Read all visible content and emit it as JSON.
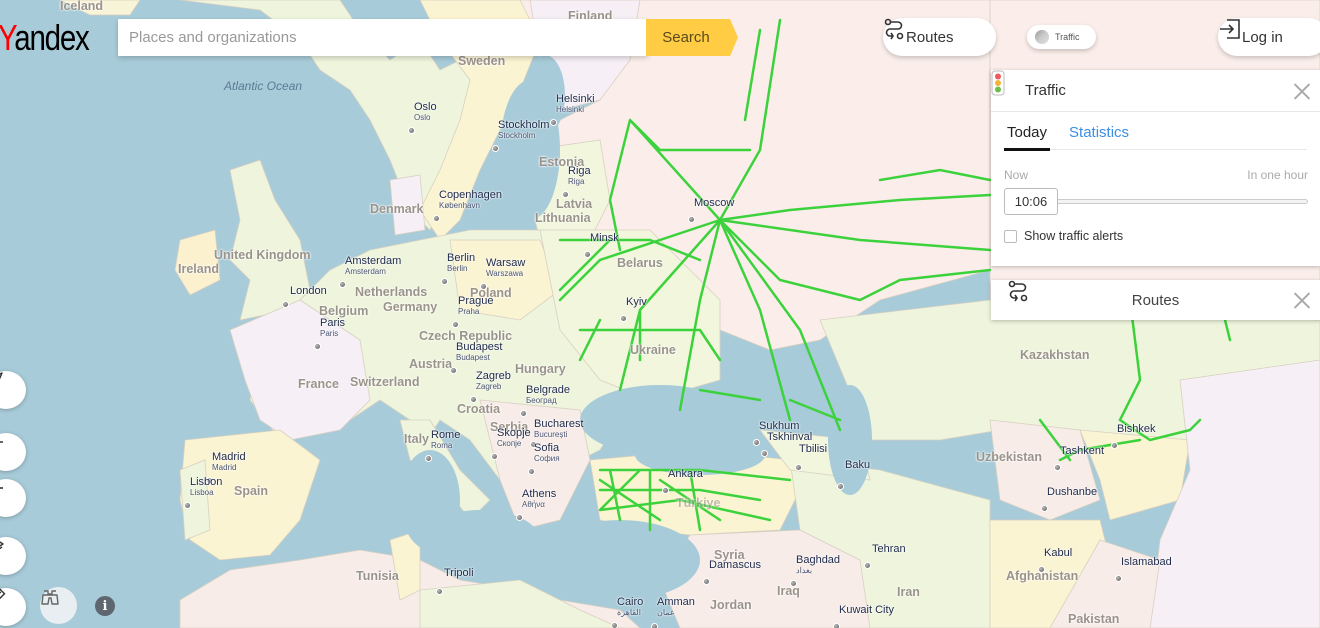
{
  "header": {
    "logo_first": "Y",
    "logo_rest": "andex",
    "search_placeholder": "Places and organizations",
    "search_value": "",
    "search_button": "Search",
    "routes_button": "Routes",
    "traffic_toggle": "Traffic",
    "login_button": "Log in"
  },
  "traffic_panel": {
    "title": "Traffic",
    "tabs": [
      {
        "label": "Today",
        "active": true
      },
      {
        "label": "Statistics",
        "active": false
      }
    ],
    "range_start": "Now",
    "range_end": "In one hour",
    "time": "10:06",
    "slider_position": 0,
    "alerts_label": "Show traffic alerts",
    "alerts_checked": false,
    "traffic_light_colors": [
      "#f05a5a",
      "#f5b23a",
      "#6cbf4a"
    ]
  },
  "routes_panel": {
    "title": "Routes"
  },
  "controls": {
    "locate": "navigation-arrow",
    "zoom_in": "plus",
    "zoom_out": "minus",
    "layers": "layers",
    "ruler": "ruler",
    "panorama": "binoculars",
    "info": "info"
  },
  "map": {
    "ocean_labels": [
      "Atlantic Ocean"
    ],
    "countries": [
      "Iceland",
      "Finland",
      "Sweden",
      "Estonia",
      "Latvia",
      "Lithuania",
      "Denmark",
      "United Kingdom",
      "Ireland",
      "Netherlands",
      "Belgium",
      "Germany",
      "Poland",
      "Belarus",
      "Czech Republic",
      "Austria",
      "Hungary",
      "Switzerland",
      "France",
      "Ukraine",
      "Croatia",
      "Serbia",
      "Italy",
      "Spain",
      "Tunisia",
      "Syria",
      "Iraq",
      "Iran",
      "Jordan",
      "Kazakhstan",
      "Uzbekistan",
      "Afghanistan",
      "Pakistan",
      "Türkiye"
    ],
    "cities": [
      {
        "name": "Oslo",
        "local": "Oslo"
      },
      {
        "name": "Stockholm",
        "local": "Stockholm"
      },
      {
        "name": "Helsinki",
        "local": "Helsinki"
      },
      {
        "name": "Riga",
        "local": "Riga"
      },
      {
        "name": "Copenhagen",
        "local": "København"
      },
      {
        "name": "Amsterdam",
        "local": "Amsterdam"
      },
      {
        "name": "Berlin",
        "local": "Berlin"
      },
      {
        "name": "Warsaw",
        "local": "Warszawa"
      },
      {
        "name": "London",
        "local": ""
      },
      {
        "name": "Paris",
        "local": "Paris"
      },
      {
        "name": "Prague",
        "local": "Praha"
      },
      {
        "name": "Budapest",
        "local": "Budapest"
      },
      {
        "name": "Zagreb",
        "local": "Zagreb"
      },
      {
        "name": "Belgrade",
        "local": "Београд"
      },
      {
        "name": "Bucharest",
        "local": "București"
      },
      {
        "name": "Rome",
        "local": "Roma"
      },
      {
        "name": "Skopje",
        "local": "Скопје"
      },
      {
        "name": "Sofia",
        "local": "София"
      },
      {
        "name": "Madrid",
        "local": "Madrid"
      },
      {
        "name": "Lisbon",
        "local": "Lisboa"
      },
      {
        "name": "Athens",
        "local": "Αθήνα"
      },
      {
        "name": "Tripoli",
        "local": ""
      },
      {
        "name": "Minsk",
        "local": ""
      },
      {
        "name": "Moscow",
        "local": ""
      },
      {
        "name": "Kyiv",
        "local": ""
      },
      {
        "name": "Ankara",
        "local": ""
      },
      {
        "name": "Sukhum",
        "local": ""
      },
      {
        "name": "Tskhinval",
        "local": ""
      },
      {
        "name": "Tbilisi",
        "local": ""
      },
      {
        "name": "Baku",
        "local": ""
      },
      {
        "name": "Tehran",
        "local": ""
      },
      {
        "name": "Baghdad",
        "local": "بغداد"
      },
      {
        "name": "Damascus",
        "local": ""
      },
      {
        "name": "Amman",
        "local": "عمان"
      },
      {
        "name": "Cairo",
        "local": "القاهرة"
      },
      {
        "name": "Kuwait City",
        "local": ""
      },
      {
        "name": "Tashkent",
        "local": ""
      },
      {
        "name": "Bishkek",
        "local": ""
      },
      {
        "name": "Dushanbe",
        "local": ""
      },
      {
        "name": "Kabul",
        "local": ""
      },
      {
        "name": "Islamabad",
        "local": ""
      }
    ]
  }
}
